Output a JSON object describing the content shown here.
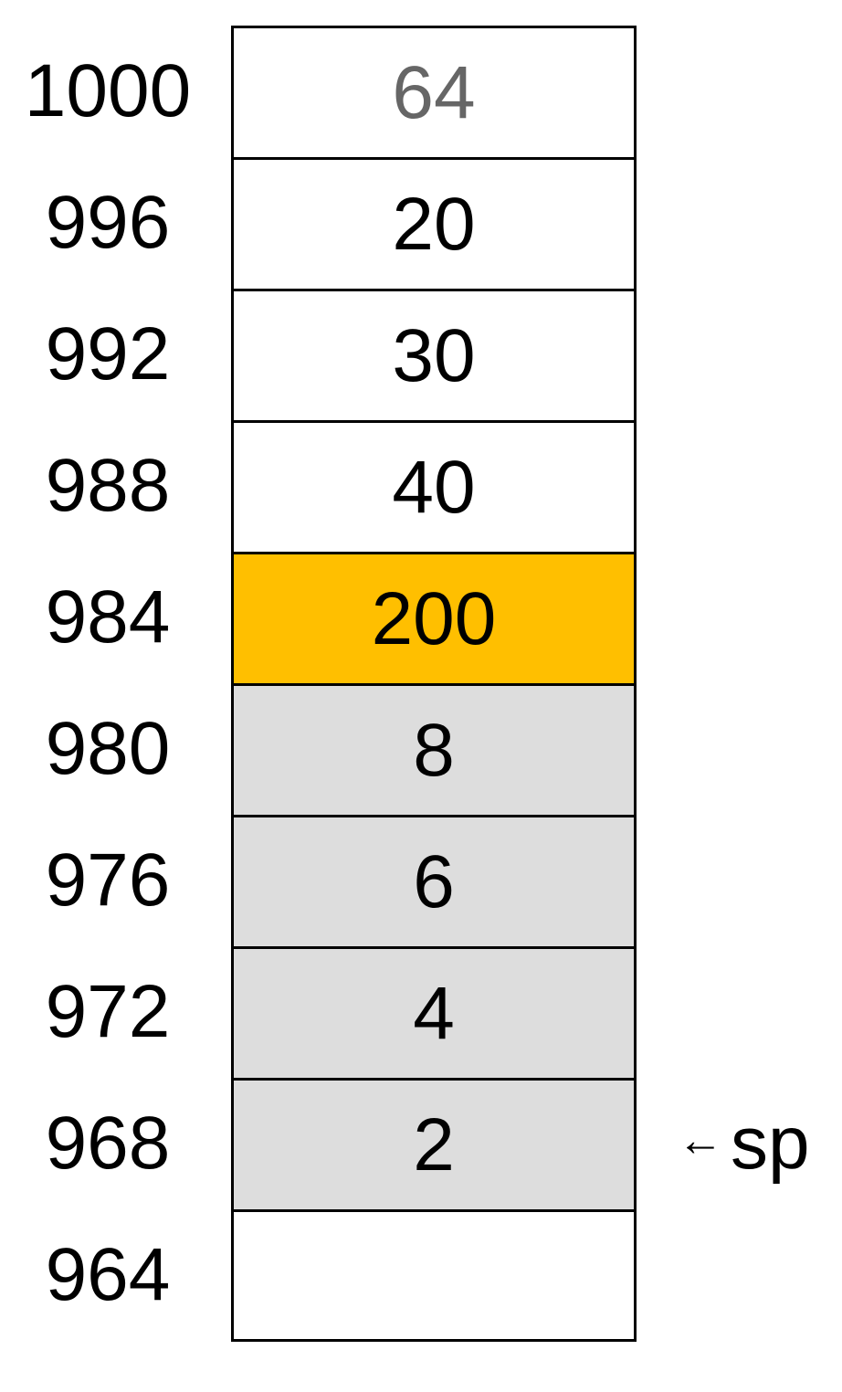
{
  "colors": {
    "highlight": "#FFBF00",
    "stacked": "#DDDDDD",
    "empty": "#FFFFFF",
    "muted_text": "#666666"
  },
  "rows": [
    {
      "address": "1000",
      "value": "64",
      "fill": "empty",
      "muted": true
    },
    {
      "address": "996",
      "value": "20",
      "fill": "empty"
    },
    {
      "address": "992",
      "value": "30",
      "fill": "empty"
    },
    {
      "address": "988",
      "value": "40",
      "fill": "empty"
    },
    {
      "address": "984",
      "value": "200",
      "fill": "highlight"
    },
    {
      "address": "980",
      "value": "8",
      "fill": "stacked"
    },
    {
      "address": "976",
      "value": "6",
      "fill": "stacked"
    },
    {
      "address": "972",
      "value": "4",
      "fill": "stacked"
    },
    {
      "address": "968",
      "value": "2",
      "fill": "stacked"
    },
    {
      "address": "964",
      "value": "",
      "fill": "empty"
    }
  ],
  "pointer": {
    "arrow": "←",
    "label": "sp",
    "row_address": "968"
  }
}
